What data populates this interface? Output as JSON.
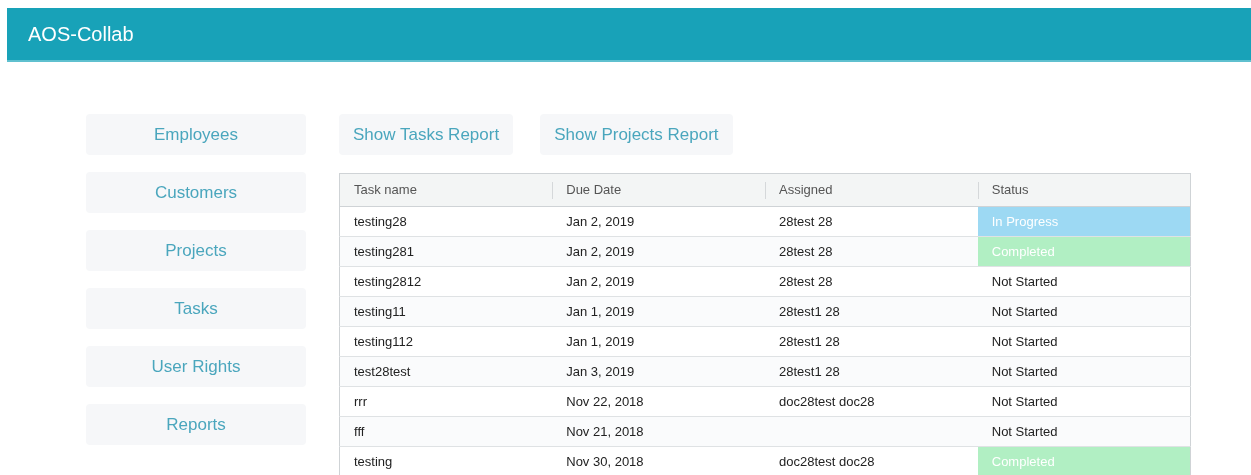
{
  "header": {
    "title": "AOS-Collab"
  },
  "sidebar": {
    "items": [
      "Employees",
      "Customers",
      "Projects",
      "Tasks",
      "User Rights",
      "Reports"
    ]
  },
  "report_buttons": [
    "Show Tasks Report",
    "Show Projects Report"
  ],
  "table": {
    "columns": [
      "Task name",
      "Due Date",
      "Assigned",
      "Status"
    ],
    "rows": [
      {
        "task": "testing28",
        "due": "Jan 2, 2019",
        "assigned": "28test 28",
        "status": "In Progress",
        "kind": "in_progress"
      },
      {
        "task": "testing281",
        "due": "Jan 2, 2019",
        "assigned": "28test 28",
        "status": "Completed",
        "kind": "completed"
      },
      {
        "task": "testing2812",
        "due": "Jan 2, 2019",
        "assigned": "28test 28",
        "status": "Not Started",
        "kind": "not_started"
      },
      {
        "task": "testing11",
        "due": "Jan 1, 2019",
        "assigned": "28test1 28",
        "status": "Not Started",
        "kind": "not_started"
      },
      {
        "task": "testing112",
        "due": "Jan 1, 2019",
        "assigned": "28test1 28",
        "status": "Not Started",
        "kind": "not_started"
      },
      {
        "task": "test28test",
        "due": "Jan 3, 2019",
        "assigned": "28test1 28",
        "status": "Not Started",
        "kind": "not_started"
      },
      {
        "task": "rrr",
        "due": "Nov 22, 2018",
        "assigned": "doc28test doc28",
        "status": "Not Started",
        "kind": "not_started"
      },
      {
        "task": "fff",
        "due": "Nov 21, 2018",
        "status": "Not Started",
        "kind": "not_started"
      },
      {
        "task": "testing",
        "due": "Nov 30, 2018",
        "assigned": "doc28test doc28",
        "status": "Completed",
        "kind": "completed"
      }
    ]
  }
}
